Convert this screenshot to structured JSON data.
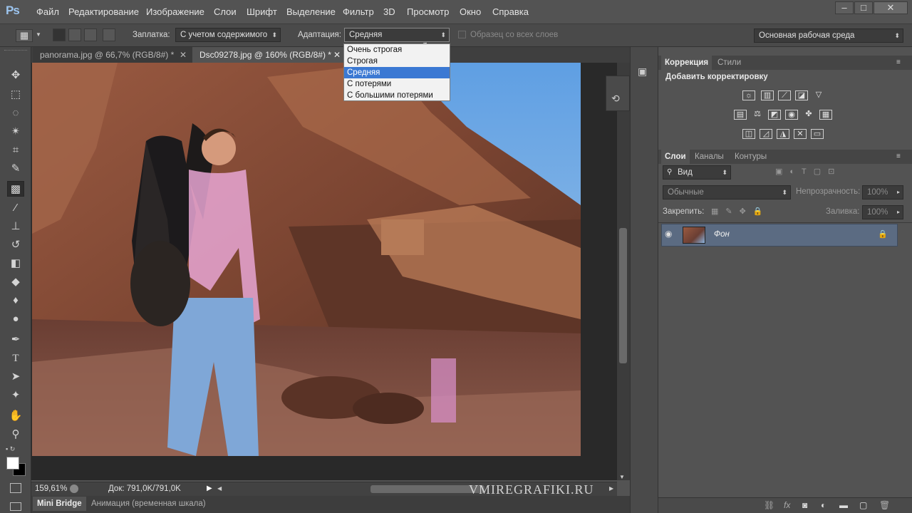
{
  "app": {
    "logo": "Ps"
  },
  "menu": [
    "Файл",
    "Редактирование",
    "Изображение",
    "Слои",
    "Шрифт",
    "Выделение",
    "Фильтр",
    "3D",
    "Просмотр",
    "Окно",
    "Справка"
  ],
  "window_controls": {
    "minimize": "–",
    "maximize": "□",
    "close": "✕"
  },
  "options": {
    "patch_label": "Заплатка:",
    "patch_value": "С учетом содержимого",
    "adapt_label": "Адаптация:",
    "adapt_value": "Средняя",
    "sample_all_label": "Образец со всех слоев",
    "workspace": "Основная рабочая среда"
  },
  "adapt_options": [
    "Очень строгая",
    "Строгая",
    "Средняя",
    "С потерями",
    "С большими потерями"
  ],
  "adapt_selected_index": 2,
  "tabs": [
    {
      "label": "panorama.jpg @ 66,7% (RGB/8#) *",
      "close": "✕"
    },
    {
      "label": "Dsc09278.jpg @ 160% (RGB/8#) *",
      "close": "✕"
    }
  ],
  "status": {
    "zoom": "159,61%",
    "doc": "Док: 791,0K/791,0K",
    "watermark": "VMIREGRAFIKI.RU"
  },
  "bottom_tabs": [
    "Mini Bridge",
    "Анимация (временная шкала)"
  ],
  "adjustments": {
    "tabs": [
      "Коррекция",
      "Стили"
    ],
    "heading": "Добавить корректировку"
  },
  "layers": {
    "tabs": [
      "Слои",
      "Каналы",
      "Контуры"
    ],
    "filter_label": "Вид",
    "blend_mode": "Обычные",
    "opacity_label": "Непрозрачность:",
    "opacity_value": "100%",
    "lock_label": "Закрепить:",
    "fill_label": "Заливка:",
    "fill_value": "100%",
    "items": [
      {
        "name": "Фон",
        "locked": true,
        "visible": true
      }
    ]
  },
  "icons": {
    "tools": [
      "move-icon",
      "marquee-icon",
      "lasso-icon",
      "magic-wand-icon",
      "crop-icon",
      "eyedropper-icon",
      "patch-tool-icon",
      "brush-icon",
      "stamp-icon",
      "history-brush-icon",
      "eraser-icon",
      "bucket-icon",
      "blur-icon",
      "dodge-icon",
      "pen-icon",
      "type-icon",
      "path-select-icon",
      "shape-icon",
      "hand-icon",
      "zoom-icon"
    ]
  }
}
